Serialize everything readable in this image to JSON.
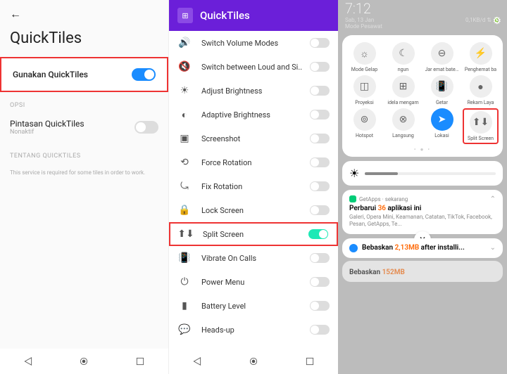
{
  "panel1": {
    "title": "QuickTiles",
    "main_toggle": "Gunakan QuickTiles",
    "section_opsi": "OPSI",
    "shortcut_label": "Pintasan QuickTiles",
    "shortcut_sub": "Nonaktif",
    "section_about": "TENTANG QUICKTILES",
    "note": "This service is required for some tiles in order to work."
  },
  "panel2": {
    "title": "QuickTiles",
    "rows": [
      {
        "icon": "🔊",
        "label": "Switch Volume Modes",
        "on": false,
        "hl": false
      },
      {
        "icon": "🔇",
        "label": "Switch between Loud and Si..",
        "on": false,
        "hl": false
      },
      {
        "icon": "☀",
        "label": "Adjust Brightness",
        "on": false,
        "hl": false
      },
      {
        "icon": "◐",
        "label": "Adaptive Brightness",
        "on": false,
        "hl": false
      },
      {
        "icon": "▣",
        "label": "Screenshot",
        "on": false,
        "hl": false
      },
      {
        "icon": "⟲",
        "label": "Force Rotation",
        "on": false,
        "hl": false
      },
      {
        "icon": "⤿",
        "label": "Fix Rotation",
        "on": false,
        "hl": false
      },
      {
        "icon": "🔒",
        "label": "Lock Screen",
        "on": false,
        "hl": false
      },
      {
        "icon": "⬆⬇",
        "label": "Split Screen",
        "on": true,
        "hl": true
      },
      {
        "icon": "📳",
        "label": "Vibrate On Calls",
        "on": false,
        "hl": false
      },
      {
        "icon": "⏻",
        "label": "Power Menu",
        "on": false,
        "hl": false
      },
      {
        "icon": "▮",
        "label": "Battery Level",
        "on": false,
        "hl": false
      },
      {
        "icon": "💬",
        "label": "Heads-up",
        "on": false,
        "hl": false
      }
    ]
  },
  "panel3": {
    "time": "7:12",
    "date": "Sab, 13 Jan",
    "mode": "Mode Pesawat",
    "data_rate": "0,1KB/d",
    "tiles": [
      {
        "icon": "☼",
        "label": "Mode Gelap",
        "hl": false,
        "blue": false
      },
      {
        "icon": "☾",
        "label": "ngun",
        "hl": false,
        "blue": false
      },
      {
        "icon": "⊖",
        "label": "Jar   emat baterai",
        "hl": false,
        "blue": false
      },
      {
        "icon": "⚡",
        "label": "Penghemat ba",
        "hl": false,
        "blue": false
      },
      {
        "icon": "◫",
        "label": "Proyeksi",
        "hl": false,
        "blue": false
      },
      {
        "icon": "⊞",
        "label": "idela mengam",
        "hl": false,
        "blue": false
      },
      {
        "icon": "📳",
        "label": "Getar",
        "hl": false,
        "blue": false
      },
      {
        "icon": "●",
        "label": "Rekam Laya",
        "hl": false,
        "blue": false
      },
      {
        "icon": "⊚",
        "label": "Hotspot",
        "hl": false,
        "blue": false
      },
      {
        "icon": "⊗",
        "label": "Langsung",
        "hl": false,
        "blue": false
      },
      {
        "icon": "➤",
        "label": "Lokasi",
        "hl": false,
        "blue": true
      },
      {
        "icon": "⬆⬇",
        "label": "Split Screen",
        "hl": true,
        "blue": false
      }
    ],
    "notif1": {
      "app": "GetApps · sekarang",
      "title_a": "Perbarui ",
      "title_b": "36",
      "title_c": " aplikasi ini",
      "body": "Galeri, Opera Mini, Keamanan, Catatan, TikTok, Facebook, Pesan, GetApps, Te..."
    },
    "notif2": {
      "title_a": "Bebaskan ",
      "title_b": "2,13MB",
      "title_c": " after installi..."
    },
    "notif3": {
      "title_a": "Bebaskan ",
      "title_b": "152MB"
    }
  }
}
